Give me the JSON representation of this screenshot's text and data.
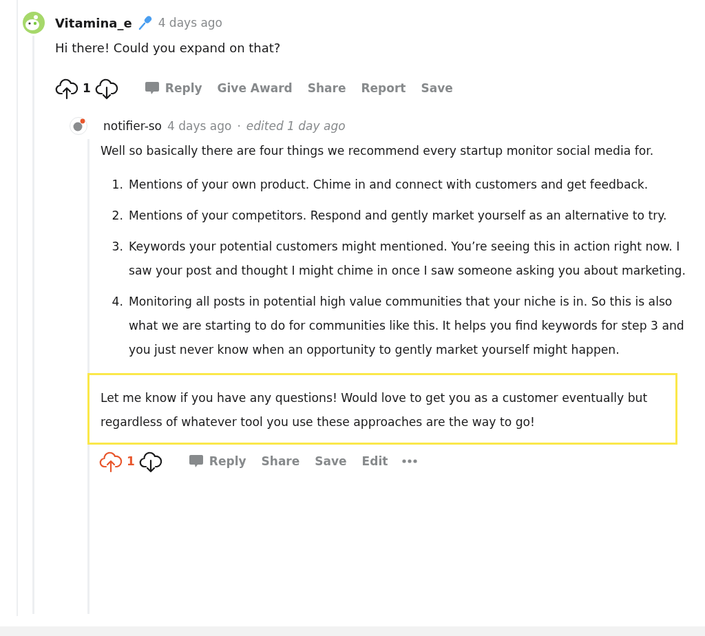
{
  "comments": [
    {
      "author": "Vitamina_e",
      "has_mic": true,
      "time": "4 days ago",
      "body": [
        {
          "kind": "paragraph",
          "text": "Hi there! Could you expand on that?",
          "highlighted": false
        }
      ],
      "votes": "1",
      "upvoted": false,
      "actions": [
        {
          "kind": "reply",
          "label": "Reply"
        },
        {
          "kind": "plain",
          "label": "Give Award"
        },
        {
          "kind": "plain",
          "label": "Share"
        },
        {
          "kind": "plain",
          "label": "Report"
        },
        {
          "kind": "plain",
          "label": "Save"
        }
      ],
      "has_more": false,
      "replies": [
        {
          "author": "notifier-so",
          "has_mic": false,
          "time": "4 days ago",
          "dot": "·",
          "edited": "edited 1 day ago",
          "body": [
            {
              "kind": "paragraph",
              "text": "Well so basically there are four things we recommend every startup monitor social media for.",
              "highlighted": false
            },
            {
              "kind": "list",
              "items": [
                {
                  "number": "1.",
                  "text": "Mentions of your own product. Chime in and connect with customers and get feedback."
                },
                {
                  "number": "2.",
                  "text": "Mentions of your competitors. Respond and gently market yourself as an alternative to try."
                },
                {
                  "number": "3.",
                  "text": "Keywords your potential customers might mentioned. You’re seeing this in action right now. I saw your post and thought I might chime in once I saw someone asking you about marketing."
                },
                {
                  "number": "4.",
                  "text": "Monitoring all posts in potential high value communities that your niche is in. So this is also what we are starting to do for communities like this. It helps you find keywords for step 3 and you just never know when an opportunity to gently market yourself might happen."
                }
              ]
            },
            {
              "kind": "paragraph",
              "text": "Let me know if you have any questions! Would love to get you as a customer eventually but regardless of whatever tool you use these approaches are the way to go!",
              "highlighted": true
            }
          ],
          "votes": "1",
          "upvoted": true,
          "actions": [
            {
              "kind": "reply",
              "label": "Reply"
            },
            {
              "kind": "plain",
              "label": "Share"
            },
            {
              "kind": "plain",
              "label": "Save"
            },
            {
              "kind": "plain",
              "label": "Edit"
            }
          ],
          "has_more": true
        }
      ]
    }
  ]
}
